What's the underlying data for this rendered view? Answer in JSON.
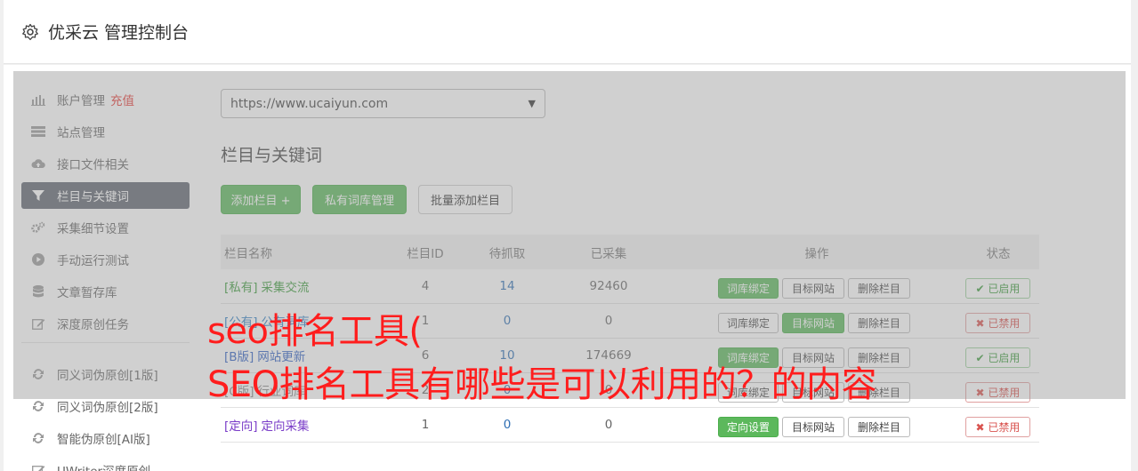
{
  "header": {
    "title": "优采云 管理控制台"
  },
  "sidebar": {
    "items": [
      {
        "label": "账户管理",
        "icon": "bar-chart-icon",
        "extra": "充值"
      },
      {
        "label": "站点管理",
        "icon": "server-icon"
      },
      {
        "label": "接口文件相关",
        "icon": "cloud-upload-icon"
      },
      {
        "label": "栏目与关键词",
        "icon": "filter-icon",
        "active": true
      },
      {
        "label": "采集细节设置",
        "icon": "gears-icon"
      },
      {
        "label": "手动运行测试",
        "icon": "play-circle-icon"
      },
      {
        "label": "文章暂存库",
        "icon": "database-icon"
      },
      {
        "label": "深度原创任务",
        "icon": "edit-icon"
      },
      {
        "label": "同义词伪原创[1版]",
        "icon": "refresh-icon"
      },
      {
        "label": "同义词伪原创[2版]",
        "icon": "refresh-icon"
      },
      {
        "label": "智能伪原创[AI版]",
        "icon": "refresh-icon"
      },
      {
        "label": "UWriter深度原创",
        "icon": "edit-icon"
      }
    ]
  },
  "main": {
    "site_select": "https://www.ucaiyun.com",
    "section_title": "栏目与关键词",
    "buttons": {
      "add": "添加栏目 +",
      "private_lib": "私有词库管理",
      "batch_add": "批量添加栏目"
    },
    "table": {
      "headers": {
        "name": "栏目名称",
        "id": "栏目ID",
        "pending": "待抓取",
        "done": "已采集",
        "op": "操作",
        "status": "状态"
      },
      "rows": [
        {
          "tag": "[私有]",
          "name": "采集交流",
          "id": "4",
          "pending": "14",
          "done": "92460",
          "op1": "词库绑定",
          "op2": "目标网站",
          "op3": "删除栏目",
          "status": "已启用"
        },
        {
          "tag": "[公有]",
          "name": "公有词库",
          "id": "1",
          "pending": "0",
          "done": "0",
          "op1": "词库绑定",
          "op2": "目标网站",
          "op3": "删除栏目",
          "status": "已禁用"
        },
        {
          "tag": "[B版]",
          "name": "网站更新",
          "id": "6",
          "pending": "10",
          "done": "174669",
          "op1": "词库绑定",
          "op2": "目标网站",
          "op3": "删除栏目",
          "status": "已启用"
        },
        {
          "tag": "[C版]",
          "name": "行业词库",
          "id": "2",
          "pending": "0",
          "done": "0",
          "op1": "词库绑定",
          "op2": "目标网站",
          "op3": "删除栏目",
          "status": "已禁用"
        },
        {
          "tag": "[定向]",
          "name": "定向采集",
          "id": "1",
          "pending": "0",
          "done": "0",
          "op1": "定向设置",
          "op2": "目标网站",
          "op3": "删除栏目",
          "status": "已禁用"
        }
      ]
    }
  },
  "overlay": {
    "line1": "seo排名工具(",
    "line2": "SEO排名工具有哪些是可以利用的？的内容"
  }
}
